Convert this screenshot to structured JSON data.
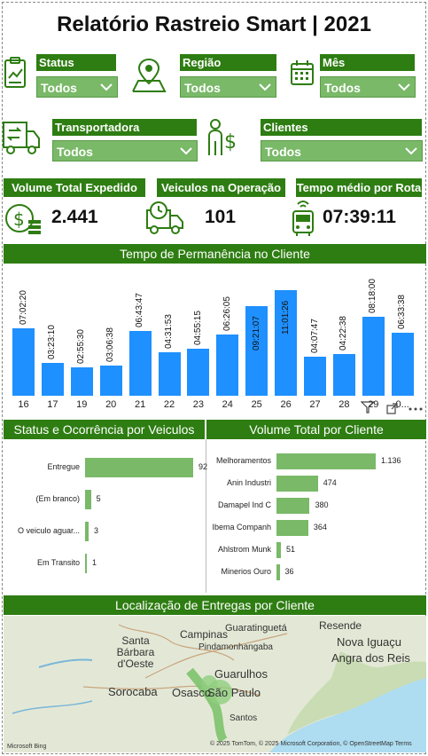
{
  "title": "Relatório Rastreio Smart | 2021",
  "slicers": {
    "status": {
      "label": "Status",
      "value": "Todos"
    },
    "regiao": {
      "label": "Região",
      "value": "Todos"
    },
    "mes": {
      "label": "Mês",
      "value": "Todos"
    },
    "transportadora": {
      "label": "Transportadora",
      "value": "Todos"
    },
    "clientes": {
      "label": "Clientes",
      "value": "Todos"
    }
  },
  "kpis": {
    "volume": {
      "label": "Volume Total Expedido",
      "value": "2.441"
    },
    "veiculos": {
      "label": "Veiculos na Operação",
      "value": "101"
    },
    "tempo": {
      "label": "Tempo médio por Rota",
      "value": "07:39:11"
    }
  },
  "permanencia": {
    "title": "Tempo de Permanência no Cliente"
  },
  "status_chart": {
    "title": "Status e Ocorrência por Veiculos"
  },
  "cliente_chart": {
    "title": "Volume Total por Cliente"
  },
  "mapa": {
    "title": "Localização de Entregas por Cliente",
    "places": [
      "Resende",
      "Campinas",
      "Guaratinguetá",
      "Santa Bárbara d'Oeste",
      "Pindamonhangaba",
      "Nova Iguaçu",
      "Angra dos Reis",
      "Guarulhos",
      "Sorocaba",
      "Osasco",
      "São Paulo",
      "Santos"
    ],
    "credit": "© 2025 TomTom, © 2025 Microsoft Corporation, © OpenStreetMap  Terms",
    "brand": "Microsoft Bing"
  },
  "colors": {
    "accent": "#2e7d12",
    "slicer": "#79b968",
    "bar": "#1e90ff"
  },
  "chart_data": [
    {
      "type": "bar",
      "title": "Tempo de Permanência no Cliente",
      "categories": [
        "16",
        "17",
        "19",
        "20",
        "21",
        "22",
        "23",
        "24",
        "25",
        "26",
        "27",
        "28",
        "29",
        "0…"
      ],
      "visible_tick_labels": [
        "16",
        "17",
        "19",
        "20",
        "21",
        "22",
        "23",
        "24",
        "25",
        "26",
        "27",
        "28",
        "29",
        "0..."
      ],
      "values": [
        7.0389,
        3.3861,
        2.925,
        3.1106,
        6.7297,
        4.5314,
        4.9208,
        6.4347,
        9.3519,
        11.0239,
        4.0797,
        4.3772,
        8.3,
        6.5606
      ],
      "labels": [
        "07:02:20",
        "03:23:10",
        "02:55:30",
        "03:06:38",
        "06:43:47",
        "04:31:53",
        "04:55:15",
        "06:26:05",
        "09:21:07",
        "11:01:26",
        "04:07:47",
        "04:22:38",
        "08:18:00",
        "06:33:38"
      ],
      "ylim": [
        0,
        11.5
      ]
    },
    {
      "type": "bar",
      "title": "Status e Ocorrência por Veiculos",
      "orientation": "horizontal",
      "categories": [
        "Entregue",
        "(Em branco)",
        "O veiculo aguar...",
        "Em Transito"
      ],
      "values": [
        92,
        5,
        3,
        1
      ],
      "labels": [
        "92",
        "5",
        "3",
        "1"
      ]
    },
    {
      "type": "bar",
      "title": "Volume Total por Cliente",
      "orientation": "horizontal",
      "categories": [
        "Melhoramentos",
        "Anin Industri",
        "Damapel Ind C",
        "Ibema Companh",
        "Ahlstrom Munk",
        "Minerios Ouro"
      ],
      "values": [
        1136,
        474,
        380,
        364,
        51,
        36
      ],
      "labels": [
        "1.136",
        "474",
        "380",
        "364",
        "51",
        "36"
      ]
    }
  ]
}
